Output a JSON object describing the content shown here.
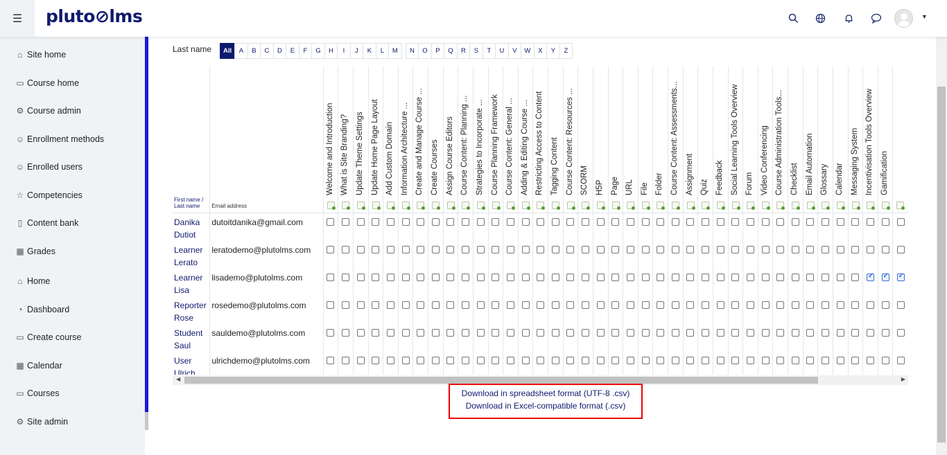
{
  "brand": {
    "logo": "plutoⓔlms"
  },
  "header": {
    "menu_icon": "hamburger-icon",
    "icons": [
      "search-icon",
      "globe-icon",
      "bell-icon",
      "chat-icon"
    ]
  },
  "sidebar": {
    "items": [
      {
        "label": "Site home",
        "icon": "home-icon"
      },
      {
        "label": "Course home",
        "icon": "folder-icon"
      },
      {
        "label": "Course admin",
        "icon": "gear-icon"
      },
      {
        "label": "Enrollment methods",
        "icon": "user-icon"
      },
      {
        "label": "Enrolled users",
        "icon": "users-icon"
      },
      {
        "label": "Competencies",
        "icon": "star-icon"
      },
      {
        "label": "Content bank",
        "icon": "clipboard-icon"
      },
      {
        "label": "Grades",
        "icon": "table-icon"
      },
      {
        "label": "Home",
        "icon": "home-icon"
      },
      {
        "label": "Dashboard",
        "icon": "gauge-icon"
      },
      {
        "label": "Create course",
        "icon": "monitor-icon"
      },
      {
        "label": "Calendar",
        "icon": "calendar-icon"
      },
      {
        "label": "Courses",
        "icon": "folder-icon"
      },
      {
        "label": "Site admin",
        "icon": "gear-icon"
      }
    ]
  },
  "filter": {
    "label": "Last name",
    "letters": [
      "All",
      "A",
      "B",
      "C",
      "D",
      "E",
      "F",
      "G",
      "H",
      "I",
      "J",
      "K",
      "L",
      "M",
      "N",
      "O",
      "P",
      "Q",
      "R",
      "S",
      "T",
      "U",
      "V",
      "W",
      "X",
      "Y",
      "Z"
    ],
    "active": "All"
  },
  "table": {
    "name_header": "First name / Last name",
    "email_header": "Email address",
    "columns": [
      "Welcome and Introduction",
      "What is Site Branding?",
      "Update Theme Settings",
      "Update Home Page Layout",
      "Add Custom Domain",
      "Information Architecture ...",
      "Create and Manage Course ...",
      "Create Courses",
      "Assign Course Editors",
      "Course Content: Planning ...",
      "Strategies to Incorporate ...",
      "Course Planning Framework",
      "Course Content: General ...",
      "Adding & Editing Course ...",
      "Restricting Access to Content",
      "Tagging Content",
      "Course Content: Resources ...",
      "SCORM",
      "H5P",
      "Page",
      "URL",
      "File",
      "Folder",
      "Course Content: Assessments...",
      "Assignment",
      "Quiz",
      "Feedback",
      "Social Learning Tools Overview",
      "Forum",
      "Video Conferencing",
      "Course Administration Tools...",
      "Checklist",
      "Email Automation",
      "Glossary",
      "Calendar",
      "Messaging System",
      "Incentivisation Tools Overview",
      "Gamification",
      ""
    ],
    "rows": [
      {
        "first": "Danika",
        "last": "Dutiot",
        "email": "dutoitdanika@gmail.com",
        "checked": []
      },
      {
        "first": "Learner",
        "last": "Lerato",
        "email": "leratodemo@plutolms.com",
        "checked": []
      },
      {
        "first": "Learner",
        "last": "Lisa",
        "email": "lisademo@plutolms.com",
        "checked": [
          36,
          37,
          38
        ]
      },
      {
        "first": "Reporter",
        "last": "Rose",
        "email": "rosedemo@plutolms.com",
        "checked": []
      },
      {
        "first": "Student",
        "last": "Saul",
        "email": "sauldemo@plutolms.com",
        "checked": []
      },
      {
        "first": "User",
        "last": "Ulrich",
        "email": "ulrichdemo@plutolms.com",
        "checked": []
      }
    ]
  },
  "downloads": {
    "utf8": "Download in spreadsheet format (UTF-8 .csv)",
    "excel": "Download in Excel-compatible format (.csv)"
  }
}
